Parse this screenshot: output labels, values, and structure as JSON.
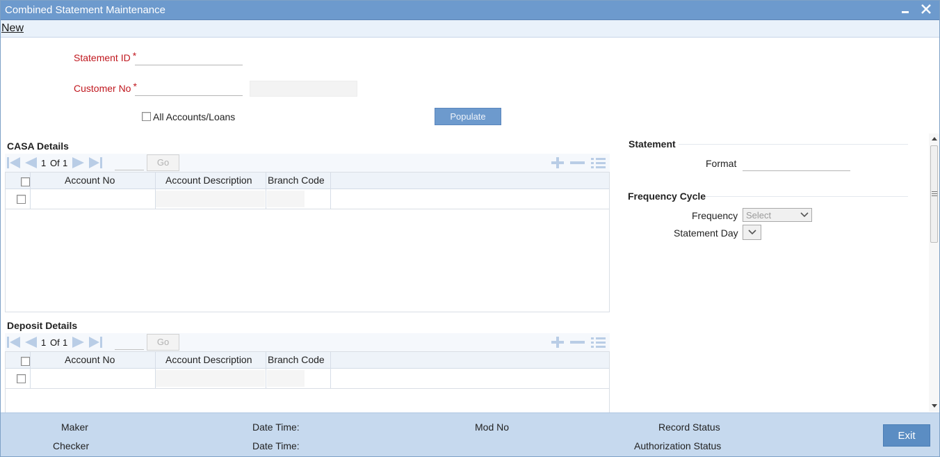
{
  "window": {
    "title": "Combined Statement Maintenance",
    "minimize_icon": "minimize-icon",
    "close_icon": "close-icon"
  },
  "toolbar": {
    "new_label": "New"
  },
  "form": {
    "statement_id_label": "Statement ID",
    "customer_no_label": "Customer No",
    "required_mark": "*",
    "statement_id_value": "",
    "customer_no_value": "",
    "all_accounts_label": "All Accounts/Loans",
    "populate_label": "Populate"
  },
  "casa": {
    "title": "CASA Details",
    "page_current": "1",
    "page_of": "Of",
    "page_total": "1",
    "go_label": "Go",
    "columns": [
      "Account No",
      "Account Description",
      "Branch Code"
    ]
  },
  "deposit": {
    "title": "Deposit Details",
    "page_current": "1",
    "page_of": "Of",
    "page_total": "1",
    "go_label": "Go",
    "columns": [
      "Account No",
      "Account Description",
      "Branch Code"
    ]
  },
  "statement": {
    "title": "Statement",
    "format_label": "Format",
    "format_value": ""
  },
  "frequency": {
    "title": "Frequency Cycle",
    "frequency_label": "Frequency",
    "frequency_value": "Select",
    "statement_day_label": "Statement Day",
    "statement_day_value": ""
  },
  "footer": {
    "maker_label": "Maker",
    "checker_label": "Checker",
    "date_time_label_1": "Date Time:",
    "date_time_label_2": "Date Time:",
    "mod_no_label": "Mod No",
    "record_status_label": "Record Status",
    "authorization_status_label": "Authorization Status",
    "exit_label": "Exit"
  },
  "colors": {
    "titlebar": "#6d9acd",
    "required": "#c0171e",
    "footer": "#c6d9ee",
    "button": "#5b8dc3"
  }
}
